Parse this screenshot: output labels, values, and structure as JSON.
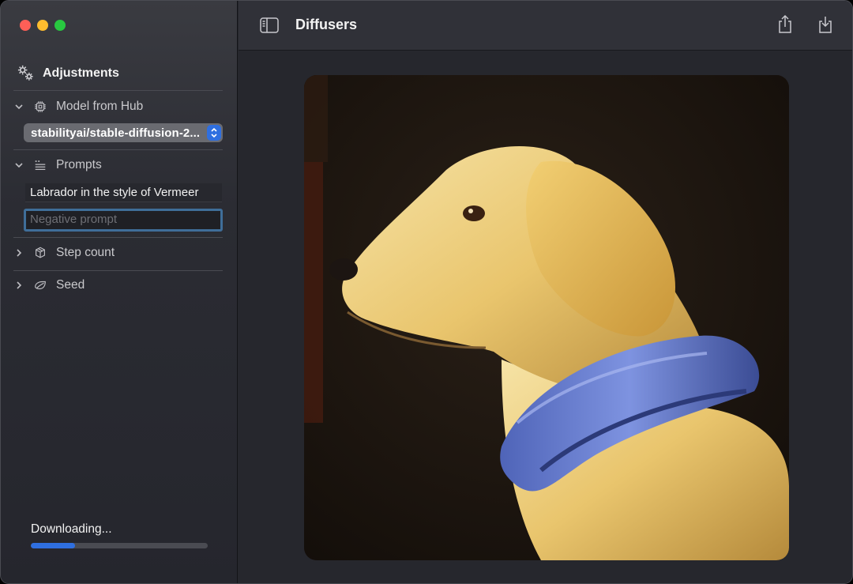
{
  "window": {
    "title": "Diffusers"
  },
  "sidebar": {
    "header": "Adjustments",
    "sections": {
      "model": {
        "label": "Model from Hub",
        "selected": "stabilityai/stable-diffusion-2..."
      },
      "prompts": {
        "label": "Prompts",
        "prompt_value": "Labrador in the style of Vermeer",
        "negative_placeholder": "Negative prompt"
      },
      "steps": {
        "label": "Step count"
      },
      "seed": {
        "label": "Seed"
      }
    },
    "status": {
      "text": "Downloading...",
      "progress": 0.25
    }
  },
  "colors": {
    "accent": "#2f6fe0",
    "focus_ring": "#3f6e99"
  },
  "icons": {
    "adjustments": "gears-icon",
    "model": "cpu-icon",
    "prompts": "text-list-icon",
    "steps": "cube-stack-icon",
    "seed": "leaf-icon"
  }
}
